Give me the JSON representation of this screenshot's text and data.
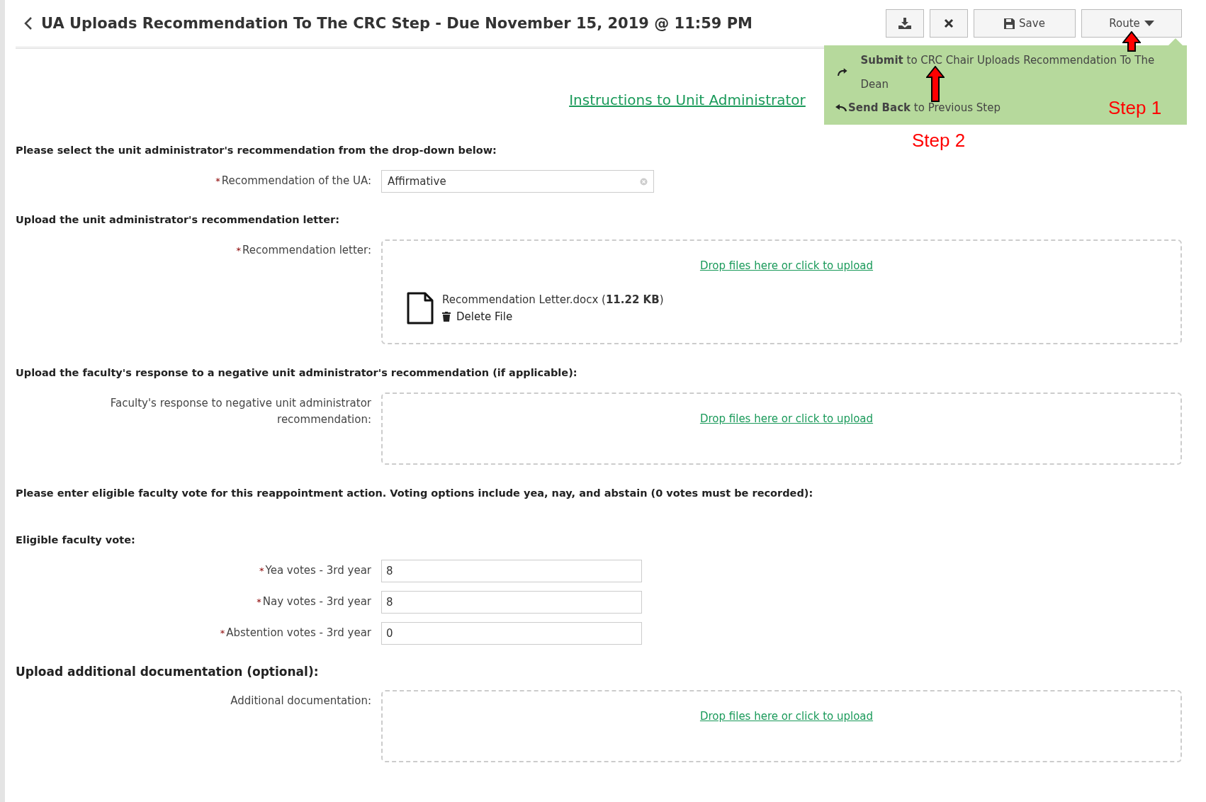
{
  "header": {
    "title": "UA Uploads Recommendation To The CRC Step - Due November 15, 2019 @ 11:59 PM",
    "buttons": [
      {
        "kind": "download"
      },
      {
        "kind": "close"
      },
      {
        "kind": "save",
        "label": "Save"
      },
      {
        "kind": "route",
        "label": "Route",
        "expanded": true
      }
    ]
  },
  "route_menu": {
    "items": [
      {
        "kind": "submit",
        "text": "**Submit** to CRC Chair Uploads Recommendation To The Dean"
      },
      {
        "kind": "send_back",
        "text": "**Send Back** to Previous Step"
      }
    ]
  },
  "annotations": [
    {
      "label": "Step 1"
    },
    {
      "label": "Step 2"
    }
  ],
  "instructions_link": "Instructions to Unit Administrator",
  "sections": [
    {
      "heading": "Please select the unit administrator's recommendation from the drop-down below:",
      "kind": "normal",
      "fields": [
        {
          "kind": "select",
          "label": "Recommendation of the UA:",
          "marker": "*",
          "value": "Affirmative"
        }
      ]
    },
    {
      "heading": "Upload the unit administrator's recommendation letter:",
      "kind": "normal",
      "fields": [
        {
          "kind": "upload",
          "label": "Recommendation letter:",
          "marker": "*",
          "dropzone": "Drop files here or click to upload",
          "files": [
            {
              "name": "Recommendation Letter.docx (**11.22 KB**)",
              "delete": "Delete File"
            }
          ]
        }
      ]
    },
    {
      "heading": "Upload the faculty's response to a negative unit administrator's recommendation (if applicable):",
      "kind": "normal",
      "fields": [
        {
          "kind": "upload",
          "label": "Faculty's response to negative unit administrator recommendation:",
          "dropzone": "Drop files here or click to upload"
        }
      ]
    },
    {
      "heading": "Please enter eligible faculty vote for this reappointment action.  Voting options include yea, nay, and abstain (0 votes must be recorded):",
      "kind": "normal"
    },
    {
      "heading": "Eligible faculty vote:",
      "kind": "normal",
      "fields": [
        {
          "kind": "text",
          "label": "Yea votes - 3rd year",
          "marker": "*",
          "value": "8"
        },
        {
          "kind": "text",
          "label": "Nay votes - 3rd year",
          "marker": "*",
          "value": "8"
        },
        {
          "kind": "text",
          "label": "Abstention votes - 3rd year",
          "marker": "*",
          "value": "0"
        }
      ]
    },
    {
      "heading": "Upload additional documentation (optional):",
      "kind": "large",
      "fields": [
        {
          "kind": "upload",
          "label": "Additional documentation:",
          "dropzone": "Drop files here or click to upload"
        }
      ]
    }
  ]
}
